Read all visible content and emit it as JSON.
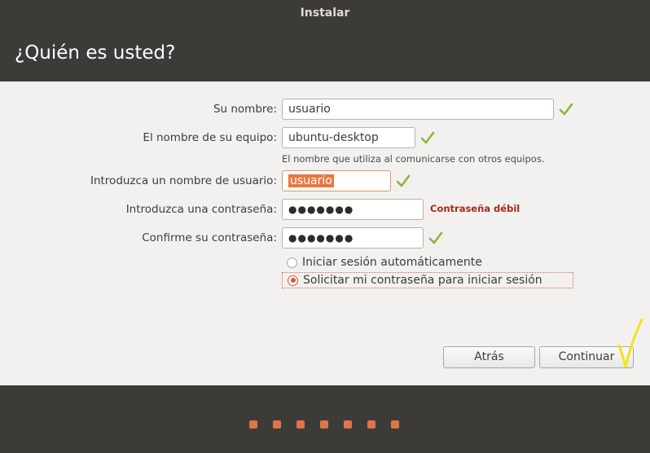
{
  "window": {
    "title": "Instalar"
  },
  "page": {
    "title": "¿Quién es usted?"
  },
  "form": {
    "name": {
      "label": "Su nombre:",
      "value": "usuario"
    },
    "computer": {
      "label": "El nombre de su equipo:",
      "value": "ubuntu-desktop",
      "hint": "El nombre que utiliza al comunicarse con otros equipos."
    },
    "username": {
      "label": "Introduzca un nombre de usuario:",
      "value": "usuario"
    },
    "password": {
      "label": "Introduzca una contraseña:",
      "value": "●●●●●●●",
      "strength": "Contraseña débil"
    },
    "confirm": {
      "label": "Confirme su contraseña:",
      "value": "●●●●●●●"
    },
    "login_options": [
      {
        "label": "Iniciar sesión automáticamente",
        "selected": false
      },
      {
        "label": "Solicitar mi contraseña para iniciar sesión",
        "selected": true
      }
    ]
  },
  "buttons": {
    "back": "Atrás",
    "continue": "Continuar"
  },
  "progress": {
    "steps": 7
  },
  "colors": {
    "accent": "#e9773f",
    "check": "#8ab738",
    "weak": "#a7281c",
    "dark": "#3c3b37"
  },
  "icons": {
    "check": "check-icon",
    "radio": "radio-icon"
  }
}
